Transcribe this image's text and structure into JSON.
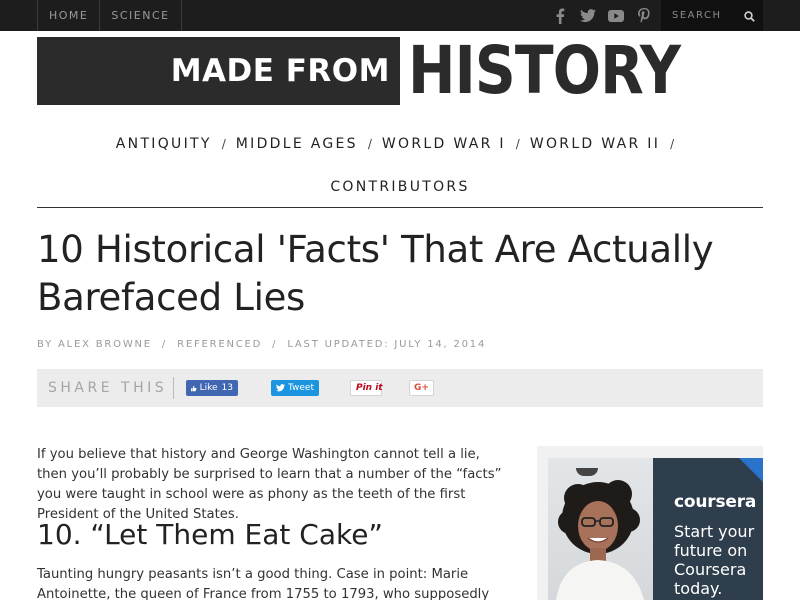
{
  "topbar": {
    "nav": [
      "HOME",
      "SCIENCE"
    ],
    "social_icons": [
      "facebook-icon",
      "twitter-icon",
      "youtube-icon",
      "pinterest-icon"
    ],
    "search_placeholder": "SEARCH"
  },
  "logo": {
    "part1": "MADE FROM",
    "part2": "HISTORY"
  },
  "categories": {
    "row1": [
      "ANTIQUITY",
      "MIDDLE AGES",
      "WORLD WAR I",
      "WORLD WAR II"
    ],
    "row2": [
      "CONTRIBUTORS"
    ],
    "separator": "/"
  },
  "article": {
    "title": "10 Historical 'Facts' That Are Actually Barefaced Lies",
    "byline": {
      "author": "BY ALEX BROWNE",
      "referenced": "REFERENCED",
      "updated": "LAST UPDATED: JULY 14, 2014",
      "separator": "/"
    },
    "intro": "If you believe that history and George Washington cannot tell a lie, then you’ll probably be surprised to learn that a number of the “facts” you were taught in school were as phony as the teeth of the first President of the United States.",
    "heading": "10. “Let Them Eat Cake”",
    "paragraph": "Taunting hungry peasants isn’t a good thing. Case in point: Marie Antoinette, the queen of France from 1755 to 1793, who supposedly dismissed her"
  },
  "share": {
    "label": "SHARE THIS",
    "facebook": {
      "label": "Like",
      "count": "13"
    },
    "twitter": "Tweet",
    "pinterest": "Pin it",
    "google": "G+"
  },
  "ad": {
    "brand": "coursera",
    "copy": "Start your future on Coursera today."
  },
  "colors": {
    "topbar": "#1d1d1d",
    "logo_dark": "#2b2b2b",
    "share_bg": "#ececec",
    "facebook": "#4267b2",
    "twitter": "#1b95e0",
    "ad_panel": "#2e3e4c"
  }
}
